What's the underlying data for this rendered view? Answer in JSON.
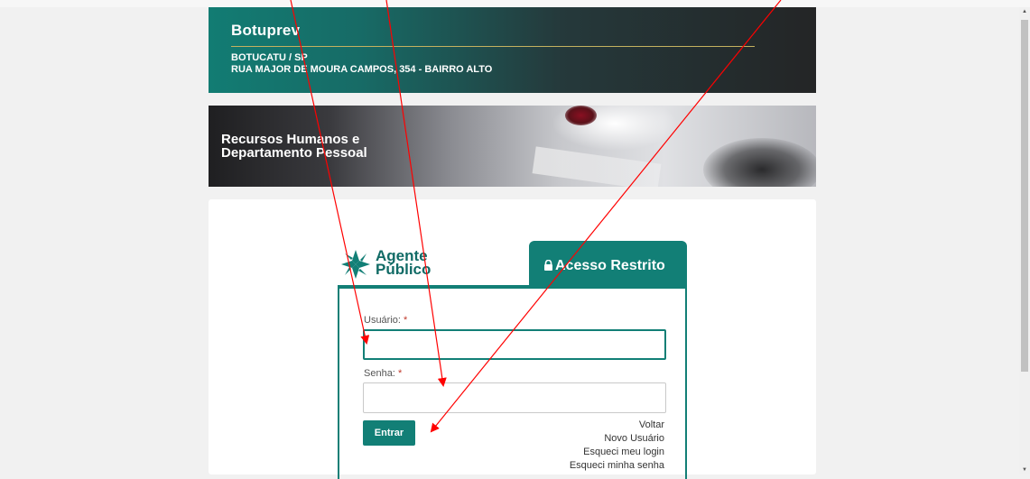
{
  "header": {
    "title": "Botuprev",
    "city": "BOTUCATU / SP",
    "address": "RUA MAJOR DE MOURA CAMPOS, 354 - BAIRRO ALTO"
  },
  "banner": {
    "line1": "Recursos Humanos e",
    "line2": "Departamento Pessoal"
  },
  "logo": {
    "line1": "Agente",
    "line2": "Público"
  },
  "tab": {
    "label": "Acesso Restrito",
    "icon": "lock-icon"
  },
  "form": {
    "username_label": "Usuário:",
    "password_label": "Senha:",
    "required_marker": "*",
    "username_value": "",
    "password_value": "",
    "submit_label": "Entrar"
  },
  "links": {
    "back": "Voltar",
    "new_user": "Novo Usuário",
    "forgot_login": "Esqueci meu login",
    "forgot_password": "Esqueci minha senha"
  },
  "colors": {
    "brand_teal": "#127f76",
    "required": "#c0392b",
    "annotation_arrows": "#ff0000",
    "header_rule": "#c4b15f"
  }
}
